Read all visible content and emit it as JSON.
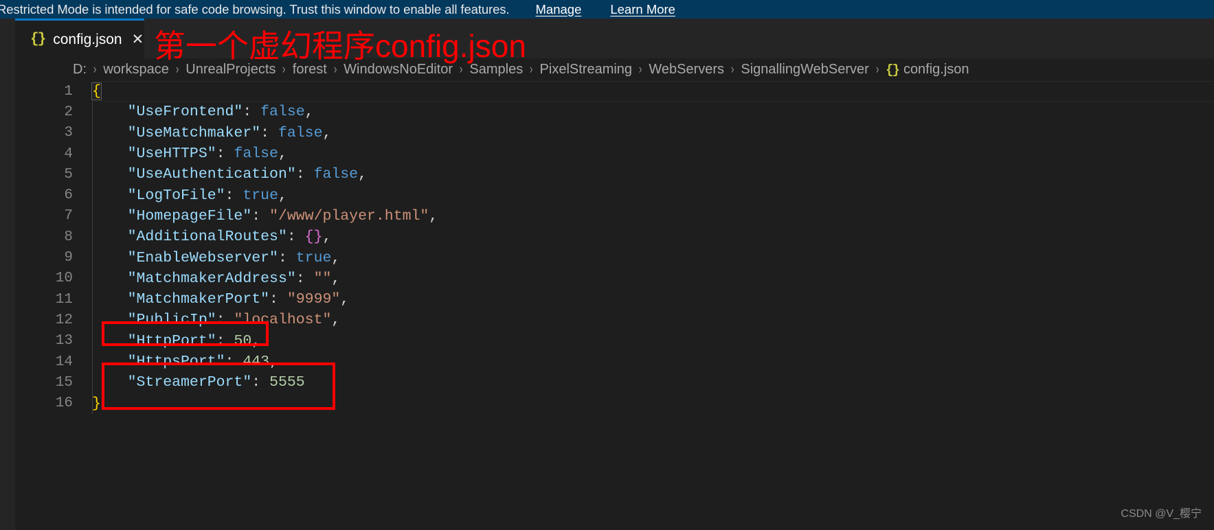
{
  "banner": {
    "message": "Restricted Mode is intended for safe code browsing. Trust this window to enable all features.",
    "manage_label": "Manage",
    "learn_more_label": "Learn More",
    "background_color": "#04395e"
  },
  "tab": {
    "icon": "json-braces-icon",
    "icon_glyph": "{}",
    "label": "config.json",
    "close_glyph": "✕",
    "active_border_color": "#0a7bcb",
    "icon_color": "#cbcb41"
  },
  "breadcrumbs": {
    "separator": "›",
    "items": [
      "D:",
      "workspace",
      "UnrealProjects",
      "forest",
      "WindowsNoEditor",
      "Samples",
      "PixelStreaming",
      "WebServers",
      "SignallingWebServer"
    ],
    "last_item": "config.json",
    "last_item_icon_glyph": "{}"
  },
  "editor": {
    "language": "json",
    "theme_background": "#1e1e1e",
    "line_numbers": [
      1,
      2,
      3,
      4,
      5,
      6,
      7,
      8,
      9,
      10,
      11,
      12,
      13,
      14,
      15,
      16
    ],
    "lines": [
      {
        "n": 1,
        "indent": 0,
        "kind": "open-brace",
        "text": "{"
      },
      {
        "n": 2,
        "indent": 1,
        "kind": "kv",
        "key": "UseFrontend",
        "value": "false",
        "value_type": "bool",
        "comma": true
      },
      {
        "n": 3,
        "indent": 1,
        "kind": "kv",
        "key": "UseMatchmaker",
        "value": "false",
        "value_type": "bool",
        "comma": true
      },
      {
        "n": 4,
        "indent": 1,
        "kind": "kv",
        "key": "UseHTTPS",
        "value": "false",
        "value_type": "bool",
        "comma": true
      },
      {
        "n": 5,
        "indent": 1,
        "kind": "kv",
        "key": "UseAuthentication",
        "value": "false",
        "value_type": "bool",
        "comma": true
      },
      {
        "n": 6,
        "indent": 1,
        "kind": "kv",
        "key": "LogToFile",
        "value": "true",
        "value_type": "bool",
        "comma": true
      },
      {
        "n": 7,
        "indent": 1,
        "kind": "kv",
        "key": "HomepageFile",
        "value": "\"/www/player.html\"",
        "value_type": "string",
        "comma": true
      },
      {
        "n": 8,
        "indent": 1,
        "kind": "kv",
        "key": "AdditionalRoutes",
        "value": "{}",
        "value_type": "object",
        "comma": true
      },
      {
        "n": 9,
        "indent": 1,
        "kind": "kv",
        "key": "EnableWebserver",
        "value": "true",
        "value_type": "bool",
        "comma": true
      },
      {
        "n": 10,
        "indent": 1,
        "kind": "kv",
        "key": "MatchmakerAddress",
        "value": "\"\"",
        "value_type": "string",
        "comma": true
      },
      {
        "n": 11,
        "indent": 1,
        "kind": "kv",
        "key": "MatchmakerPort",
        "value": "\"9999\"",
        "value_type": "string",
        "comma": true
      },
      {
        "n": 12,
        "indent": 1,
        "kind": "kv",
        "key": "PublicIp",
        "value": "\"localhost\"",
        "value_type": "string",
        "comma": true
      },
      {
        "n": 13,
        "indent": 1,
        "kind": "kv",
        "key": "HttpPort",
        "value": "50",
        "value_type": "number",
        "comma": true
      },
      {
        "n": 14,
        "indent": 1,
        "kind": "kv",
        "key": "HttpsPort",
        "value": "443",
        "value_type": "number",
        "comma": true
      },
      {
        "n": 15,
        "indent": 1,
        "kind": "kv",
        "key": "StreamerPort",
        "value": "5555",
        "value_type": "number",
        "comma": false
      },
      {
        "n": 16,
        "indent": 0,
        "kind": "close-brace",
        "text": "}"
      }
    ],
    "token_colors": {
      "key": "#9cdcfe",
      "string": "#ce9178",
      "boolean": "#569cd6",
      "number": "#b5cea8",
      "punctuation": "#d4d4d4",
      "brace": "#ffd700",
      "empty_object_brace": "#da70d6"
    }
  },
  "annotations": {
    "color": "#ff0000",
    "title_text": "第一个虚幻程序config.json",
    "highlight_boxes": [
      {
        "name": "http-port-highlight",
        "target_line": 13
      },
      {
        "name": "streamer-port-highlight",
        "target_line": 15
      }
    ]
  },
  "watermark": {
    "text": "CSDN @V_樱宁"
  }
}
